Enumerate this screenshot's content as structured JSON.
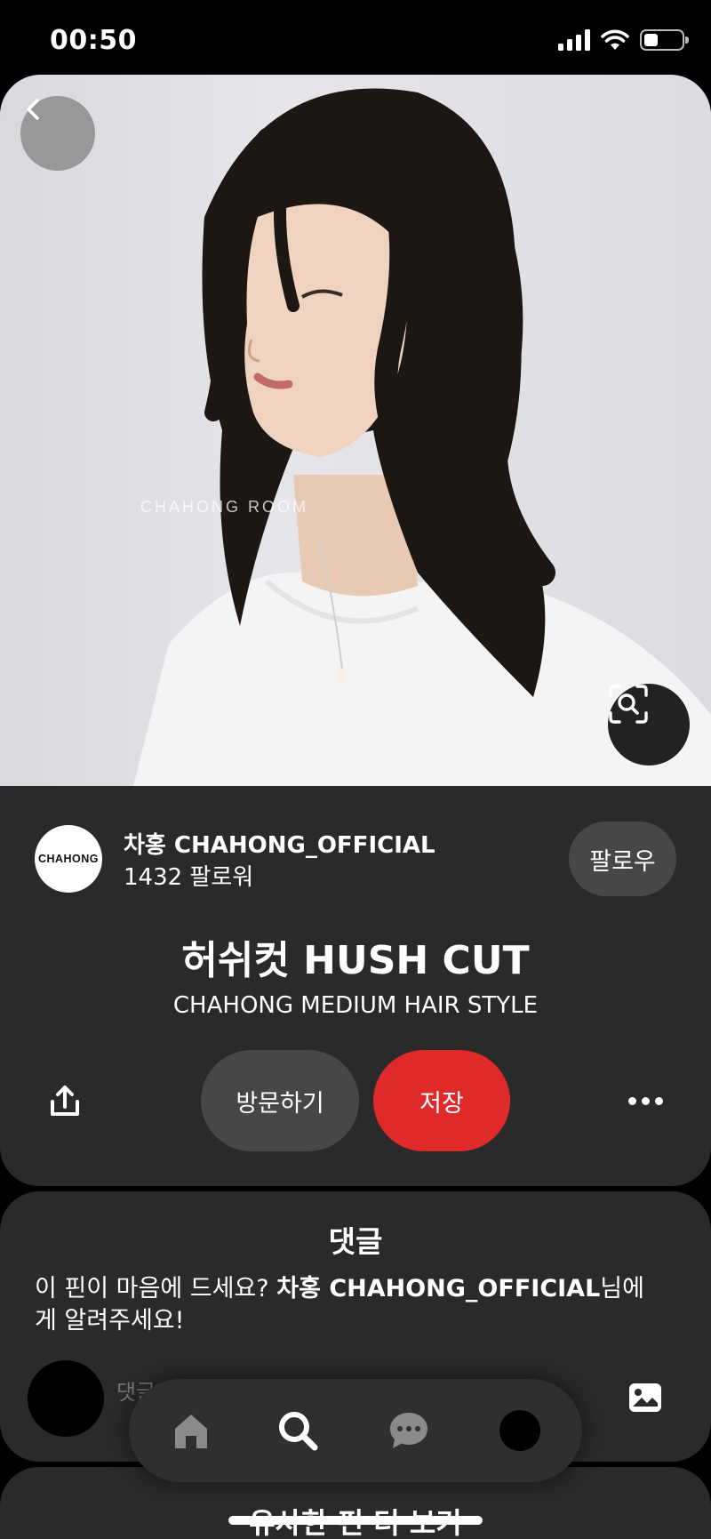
{
  "status_bar": {
    "time": "00:50",
    "battery_level": 0.38,
    "icons": [
      "signal-icon",
      "wifi-icon",
      "battery-icon"
    ]
  },
  "pin": {
    "image_description_icon": "portrait-photo",
    "watermark": "CHAHONG ROOM",
    "title": "허쉬컷 HUSH CUT",
    "subtitle": "CHAHONG MEDIUM HAIR STYLE"
  },
  "creator": {
    "logo_text": "CHAHONG",
    "name": "차홍 CHAHONG_OFFICIAL",
    "followers": "1432 팔로워",
    "follow_label": "팔로우"
  },
  "actions": {
    "visit_label": "방문하기",
    "save_label": "저장",
    "save_color": "#e02a2a"
  },
  "comments": {
    "title": "댓글",
    "prompt_prefix": "이 핀이 마음에 드세요? ",
    "prompt_creator": "차홍 CHAHONG_OFFICIAL",
    "prompt_suffix": "님에게 알려주세요!",
    "input_placeholder": "댓글"
  },
  "more_ideas": {
    "title": "유사한 핀 더 보기"
  },
  "nav": {
    "items": [
      "home-icon",
      "search-icon",
      "chat-icon",
      "profile-avatar"
    ]
  }
}
